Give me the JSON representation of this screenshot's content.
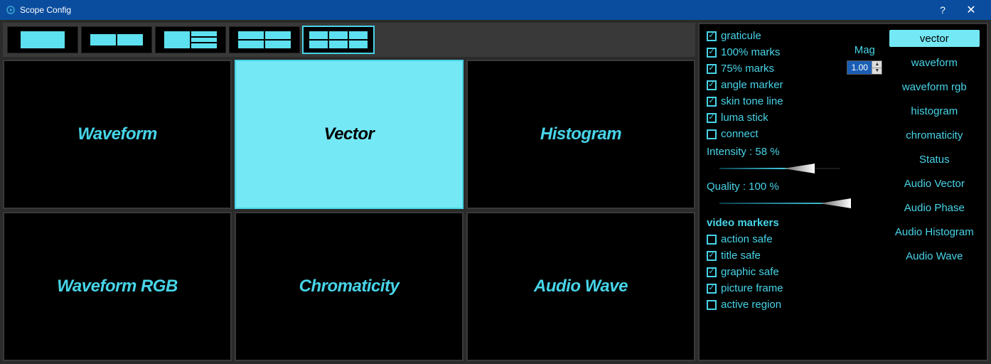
{
  "window": {
    "title": "Scope Config",
    "help": "?",
    "close": "✕"
  },
  "grid": {
    "cells": [
      {
        "label": "Waveform",
        "selected": false
      },
      {
        "label": "Vector",
        "selected": true
      },
      {
        "label": "Histogram",
        "selected": false
      },
      {
        "label": "Waveform RGB",
        "selected": false
      },
      {
        "label": "Chromaticity",
        "selected": false
      },
      {
        "label": "Audio Wave",
        "selected": false
      }
    ]
  },
  "options": {
    "checks": [
      {
        "label": "graticule",
        "checked": true
      },
      {
        "label": "100% marks",
        "checked": true
      },
      {
        "label": "75% marks",
        "checked": true
      },
      {
        "label": "angle marker",
        "checked": true
      },
      {
        "label": "skin tone line",
        "checked": true
      },
      {
        "label": "luma stick",
        "checked": true
      },
      {
        "label": "connect",
        "checked": false
      }
    ],
    "intensity_label": "Intensity : 58 %",
    "intensity_pct": 58,
    "quality_label": "Quality : 100 %",
    "quality_pct": 100,
    "video_markers_label": "video markers",
    "video_markers": [
      {
        "label": "action safe",
        "checked": false
      },
      {
        "label": "title safe",
        "checked": true
      },
      {
        "label": "graphic safe",
        "checked": true
      },
      {
        "label": "picture frame",
        "checked": true
      },
      {
        "label": "active region",
        "checked": false
      }
    ]
  },
  "mag": {
    "label": "Mag",
    "value": "1.00"
  },
  "types": [
    {
      "label": "vector",
      "selected": true
    },
    {
      "label": "waveform",
      "selected": false
    },
    {
      "label": "waveform rgb",
      "selected": false
    },
    {
      "label": "histogram",
      "selected": false
    },
    {
      "label": "chromaticity",
      "selected": false
    },
    {
      "label": "Status",
      "selected": false
    },
    {
      "label": "Audio Vector",
      "selected": false
    },
    {
      "label": "Audio Phase",
      "selected": false
    },
    {
      "label": "Audio Histogram",
      "selected": false
    },
    {
      "label": "Audio Wave",
      "selected": false
    }
  ]
}
